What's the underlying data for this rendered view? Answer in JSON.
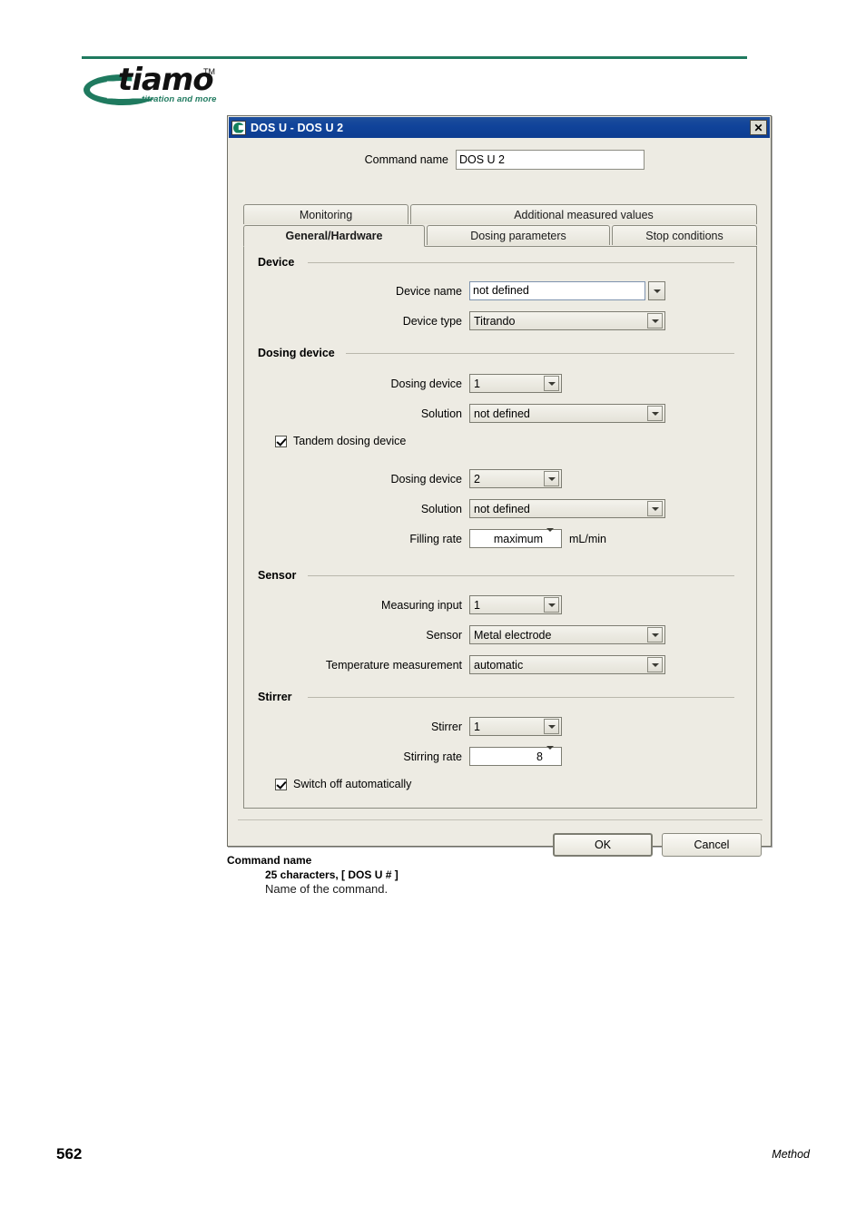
{
  "page": {
    "logo_word": "tiamo",
    "logo_tm": "TM",
    "logo_tagline": "titration and more",
    "page_number": "562",
    "footer_section": "Method",
    "accent_color": "#1f7a5f"
  },
  "dialog": {
    "title": "DOS U - DOS U 2",
    "close_label": "✕",
    "command_name": {
      "label": "Command name",
      "value": "DOS U 2"
    },
    "tabs_row1": [
      {
        "label": "Monitoring",
        "active": false
      },
      {
        "label": "Additional measured values",
        "active": false
      }
    ],
    "tabs_row2": [
      {
        "label": "General/Hardware",
        "active": true
      },
      {
        "label": "Dosing parameters",
        "active": false
      },
      {
        "label": "Stop conditions",
        "active": false
      }
    ],
    "groups": {
      "device": {
        "title": "Device",
        "device_name": {
          "label": "Device name",
          "value": "not defined"
        },
        "device_type": {
          "label": "Device type",
          "value": "Titrando"
        }
      },
      "dosing_device": {
        "title": "Dosing device",
        "dosing_device_1": {
          "label": "Dosing device",
          "value": "1"
        },
        "solution_1": {
          "label": "Solution",
          "value": "not defined"
        },
        "tandem": {
          "label": "Tandem dosing device",
          "checked": true
        },
        "dosing_device_2": {
          "label": "Dosing device",
          "value": "2"
        },
        "solution_2": {
          "label": "Solution",
          "value": "not defined"
        },
        "filling_rate": {
          "label": "Filling rate",
          "value": "maximum",
          "unit": "mL/min"
        }
      },
      "sensor": {
        "title": "Sensor",
        "measuring_input": {
          "label": "Measuring input",
          "value": "1"
        },
        "sensor": {
          "label": "Sensor",
          "value": "Metal electrode"
        },
        "temperature": {
          "label": "Temperature measurement",
          "value": "automatic"
        }
      },
      "stirrer": {
        "title": "Stirrer",
        "stirrer": {
          "label": "Stirrer",
          "value": "1"
        },
        "stirring_rate": {
          "label": "Stirring rate",
          "value": "8"
        },
        "switch_off": {
          "label": "Switch off automatically",
          "checked": true
        }
      }
    },
    "buttons": {
      "ok": "OK",
      "cancel": "Cancel"
    }
  },
  "caption": {
    "term": "Command name",
    "constraint": "25 characters, [ DOS U # ]",
    "description": "Name of the command."
  }
}
